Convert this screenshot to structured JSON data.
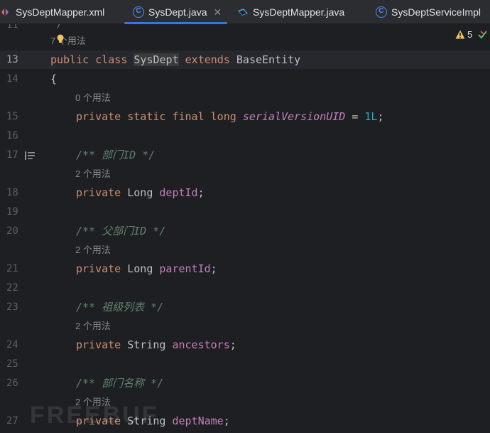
{
  "tabs": [
    {
      "label": "SysDeptMapper.xml",
      "icon": "xml-file-icon",
      "active": false
    },
    {
      "label": "SysDept.java",
      "icon": "class-icon",
      "active": true
    },
    {
      "label": "SysDeptMapper.java",
      "icon": "mapper-interface-icon",
      "active": false
    },
    {
      "label": "SysDeptServiceImpl",
      "icon": "class-icon",
      "active": false
    }
  ],
  "inspection": {
    "warning_count": "5",
    "icon": "warning-icon",
    "status_icon": "check-icon"
  },
  "editor": {
    "lines": {
      "l13": "13",
      "l14": "14",
      "l15": "15",
      "l16": "16",
      "l17": "17",
      "l18": "18",
      "l19": "19",
      "l20": "20",
      "l21": "21",
      "l22": "22",
      "l23": "23",
      "l24": "24",
      "l25": "25",
      "l26": "26",
      "l27": "27"
    },
    "usage_hints": {
      "class": "7 个用法",
      "serial": "0 个用法",
      "deptId": "2 个用法",
      "parentId": "2 个用法",
      "ancestors": "2 个用法",
      "deptName": "2 个用法"
    },
    "code": {
      "public": "public",
      "class": "class",
      "class_name": "SysDept",
      "extends": "extends",
      "base": "BaseEntity",
      "brace": "{",
      "private": "private",
      "static": "static",
      "final": "final",
      "long": "long",
      "serial": "serialVersionUID",
      "eq": "=",
      "one_l": "1L",
      "semi": ";",
      "c_deptId": "/** 部门ID */",
      "c_parentId": "/** 父部门ID */",
      "c_ancestors": "/** 祖级列表 */",
      "c_deptName": "/** 部门名称 */",
      "Long": "Long",
      "String": "String",
      "deptId": "deptId",
      "parentId": "parentId",
      "ancestors": "ancestors",
      "deptName": "deptName"
    }
  },
  "watermark": "FREEBUF",
  "colors": {
    "accent": "#3574f0",
    "keyword": "#cf8e6d",
    "field": "#c77dbb",
    "comment": "#5f826b",
    "number": "#2aacb8"
  }
}
